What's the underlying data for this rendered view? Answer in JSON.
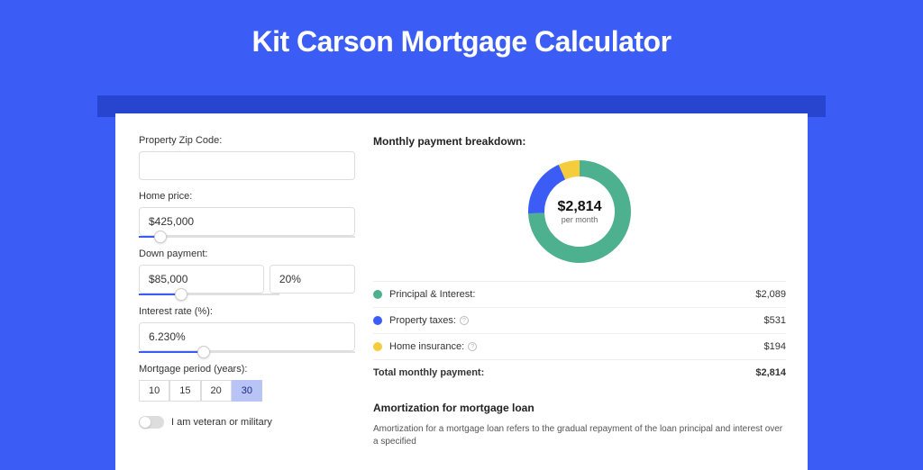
{
  "title": "Kit Carson Mortgage Calculator",
  "form": {
    "zip_label": "Property Zip Code:",
    "zip_value": "",
    "price_label": "Home price:",
    "price_value": "$425,000",
    "price_slider_pct": 10,
    "down_label": "Down payment:",
    "down_value": "$85,000",
    "down_pct_value": "20%",
    "down_slider_pct": 20,
    "rate_label": "Interest rate (%):",
    "rate_value": "6.230%",
    "rate_slider_pct": 30,
    "period_label": "Mortgage period (years):",
    "periods": [
      "10",
      "15",
      "20",
      "30"
    ],
    "period_selected": "30",
    "veteran_label": "I am veteran or military",
    "veteran_on": false
  },
  "breakdown": {
    "title": "Monthly payment breakdown:",
    "donut_amount": "$2,814",
    "donut_sub": "per month",
    "items": [
      {
        "label": "Principal & Interest:",
        "value": "$2,089",
        "color": "#4DB08E",
        "info": false
      },
      {
        "label": "Property taxes:",
        "value": "$531",
        "color": "#3B5DF5",
        "info": true
      },
      {
        "label": "Home insurance:",
        "value": "$194",
        "color": "#F5CC3B",
        "info": true
      }
    ],
    "total_label": "Total monthly payment:",
    "total_value": "$2,814"
  },
  "chart_data": {
    "type": "pie",
    "title": "Monthly payment breakdown",
    "series": [
      {
        "name": "Principal & Interest",
        "value": 2089,
        "color": "#4DB08E"
      },
      {
        "name": "Property taxes",
        "value": 531,
        "color": "#3B5DF5"
      },
      {
        "name": "Home insurance",
        "value": 194,
        "color": "#F5CC3B"
      }
    ],
    "total": 2814,
    "unit": "USD/month"
  },
  "amort": {
    "title": "Amortization for mortgage loan",
    "text": "Amortization for a mortgage loan refers to the gradual repayment of the loan principal and interest over a specified"
  }
}
